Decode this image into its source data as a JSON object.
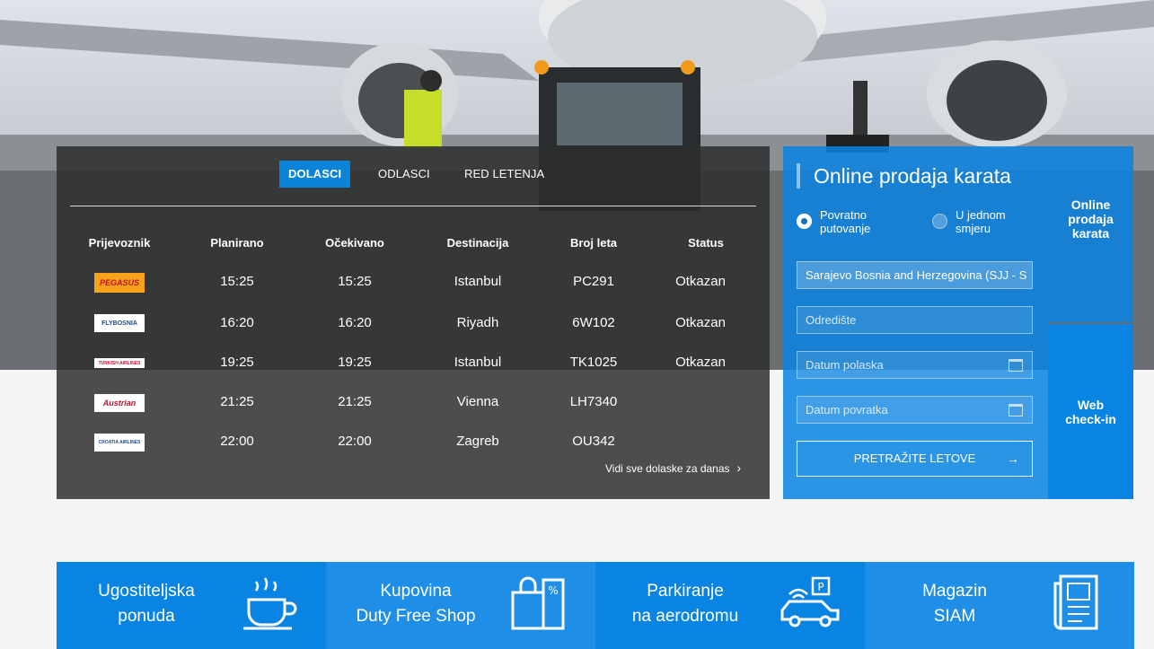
{
  "flights": {
    "tabs": [
      "DOLASCI",
      "ODLASCI",
      "RED LETENJA"
    ],
    "active_tab": "DOLASCI",
    "columns": [
      "Prijevoznik",
      "Planirano",
      "Očekivano",
      "Destinacija",
      "Broj leta",
      "Status"
    ],
    "rows": [
      {
        "airline": "PEGASUS",
        "planned": "15:25",
        "expected": "15:25",
        "destination": "Istanbul",
        "flight": "PC291",
        "status": "Otkazan"
      },
      {
        "airline": "FLYBOSNIA",
        "planned": "16:20",
        "expected": "16:20",
        "destination": "Riyadh",
        "flight": "6W102",
        "status": "Otkazan"
      },
      {
        "airline": "TURKISH AIRLINES",
        "planned": "19:25",
        "expected": "19:25",
        "destination": "Istanbul",
        "flight": "TK1025",
        "status": "Otkazan"
      },
      {
        "airline": "Austrian",
        "planned": "21:25",
        "expected": "21:25",
        "destination": "Vienna",
        "flight": "LH7340",
        "status": ""
      },
      {
        "airline": "CROATIA AIRLINES",
        "planned": "22:00",
        "expected": "22:00",
        "destination": "Zagreb",
        "flight": "OU342",
        "status": ""
      }
    ],
    "see_all": "Vidi sve dolaske za danas"
  },
  "booking": {
    "title": "Online prodaja karata",
    "radio_return": "Povratno putovanje",
    "radio_oneway": "U jednom smjeru",
    "selected": "Povratno putovanje",
    "origin_value": "Sarajevo Bosnia and Herzegovina (SJJ - S",
    "destination_placeholder": "Odredište",
    "depart_placeholder": "Datum polaska",
    "return_placeholder": "Datum povratka",
    "search_label": "PRETRAŽITE LETOVE"
  },
  "side": {
    "online": "Online prodaja karata",
    "webcheckin": "Web check-in"
  },
  "tiles": [
    {
      "line1": "Ugostiteljska",
      "line2": "ponuda",
      "icon": "coffee-cup-icon"
    },
    {
      "line1": "Kupovina",
      "line2": "Duty Free Shop",
      "icon": "shopping-bags-icon"
    },
    {
      "line1": "Parkiranje",
      "line2": "na aerodromu",
      "icon": "parking-car-icon"
    },
    {
      "line1": "Magazin",
      "line2": "SIAM",
      "icon": "magazine-icon"
    }
  ],
  "colors": {
    "accent": "#0a84e2",
    "panel_dark": "#2c2c2c"
  }
}
